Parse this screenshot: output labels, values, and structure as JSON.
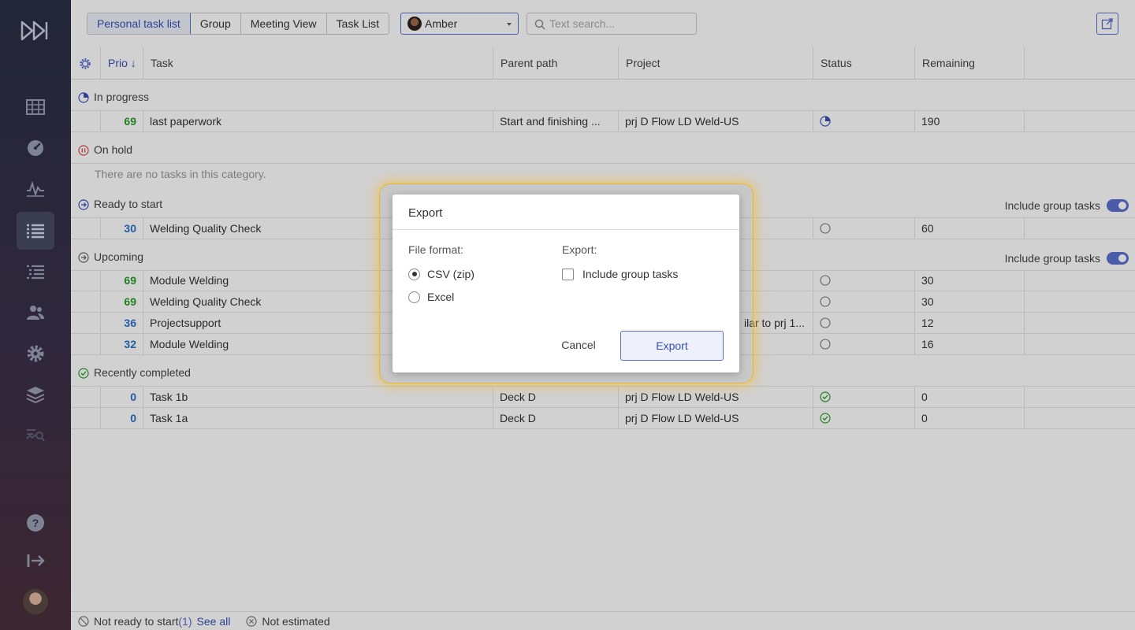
{
  "toolbar": {
    "tabs": [
      "Personal task list",
      "Group",
      "Meeting View",
      "Task List"
    ],
    "user": "Amber",
    "search_placeholder": "Text search..."
  },
  "table": {
    "headers": {
      "prio": "Prio ↓",
      "task": "Task",
      "parent": "Parent path",
      "project": "Project",
      "status": "Status",
      "remaining": "Remaining"
    }
  },
  "categories": {
    "in_progress": {
      "label": "In progress",
      "rows": [
        {
          "prio": "69",
          "task": "last paperwork",
          "parent": "Start and finishing ...",
          "project": "prj D Flow LD Weld-US",
          "status": "in-progress-icon",
          "remaining": "190"
        }
      ]
    },
    "on_hold": {
      "label": "On hold",
      "empty": "There are no tasks in this category."
    },
    "ready": {
      "label": "Ready to start",
      "toggle_label": "Include group tasks",
      "rows": [
        {
          "prio": "30",
          "task": "Welding Quality Check",
          "parent": "",
          "project": "",
          "status": "not-started-icon",
          "remaining": "60"
        }
      ]
    },
    "upcoming": {
      "label": "Upcoming",
      "toggle_label": "Include group tasks",
      "rows": [
        {
          "prio": "69",
          "task": "Module Welding",
          "parent": "",
          "project": "",
          "status": "not-started-icon",
          "remaining": "30"
        },
        {
          "prio": "69",
          "task": "Welding Quality Check",
          "parent": "",
          "project": "",
          "status": "not-started-icon",
          "remaining": "30"
        },
        {
          "prio": "36",
          "task": "Projectsupport",
          "parent": "",
          "project": "ilar to prj 1...",
          "status": "not-started-icon",
          "remaining": "12"
        },
        {
          "prio": "32",
          "task": "Module Welding",
          "parent": "",
          "project": "",
          "status": "not-started-icon",
          "remaining": "16"
        }
      ]
    },
    "completed": {
      "label": "Recently completed",
      "rows": [
        {
          "prio": "0",
          "task": "Task 1b",
          "parent": "Deck D",
          "project": "prj D Flow LD Weld-US",
          "status": "done-icon",
          "remaining": "0"
        },
        {
          "prio": "0",
          "task": "Task 1a",
          "parent": "Deck D",
          "project": "prj D Flow LD Weld-US",
          "status": "done-icon",
          "remaining": "0"
        }
      ]
    }
  },
  "footer": {
    "not_ready": "Not ready to start",
    "not_ready_count": "(1)",
    "see_all": "See all",
    "not_estimated": "Not estimated"
  },
  "dialog": {
    "title": "Export",
    "file_format_label": "File format:",
    "options": [
      "CSV (zip)",
      "Excel"
    ],
    "selected_option": "CSV (zip)",
    "export_label": "Export:",
    "include_group": "Include group tasks",
    "include_group_checked": false,
    "cancel": "Cancel",
    "export": "Export"
  },
  "colors": {
    "accent": "#5b6fd0",
    "prio_high": "#2a9c2a",
    "prio_normal": "#2a72c8",
    "highlight": "#f0b62a"
  }
}
